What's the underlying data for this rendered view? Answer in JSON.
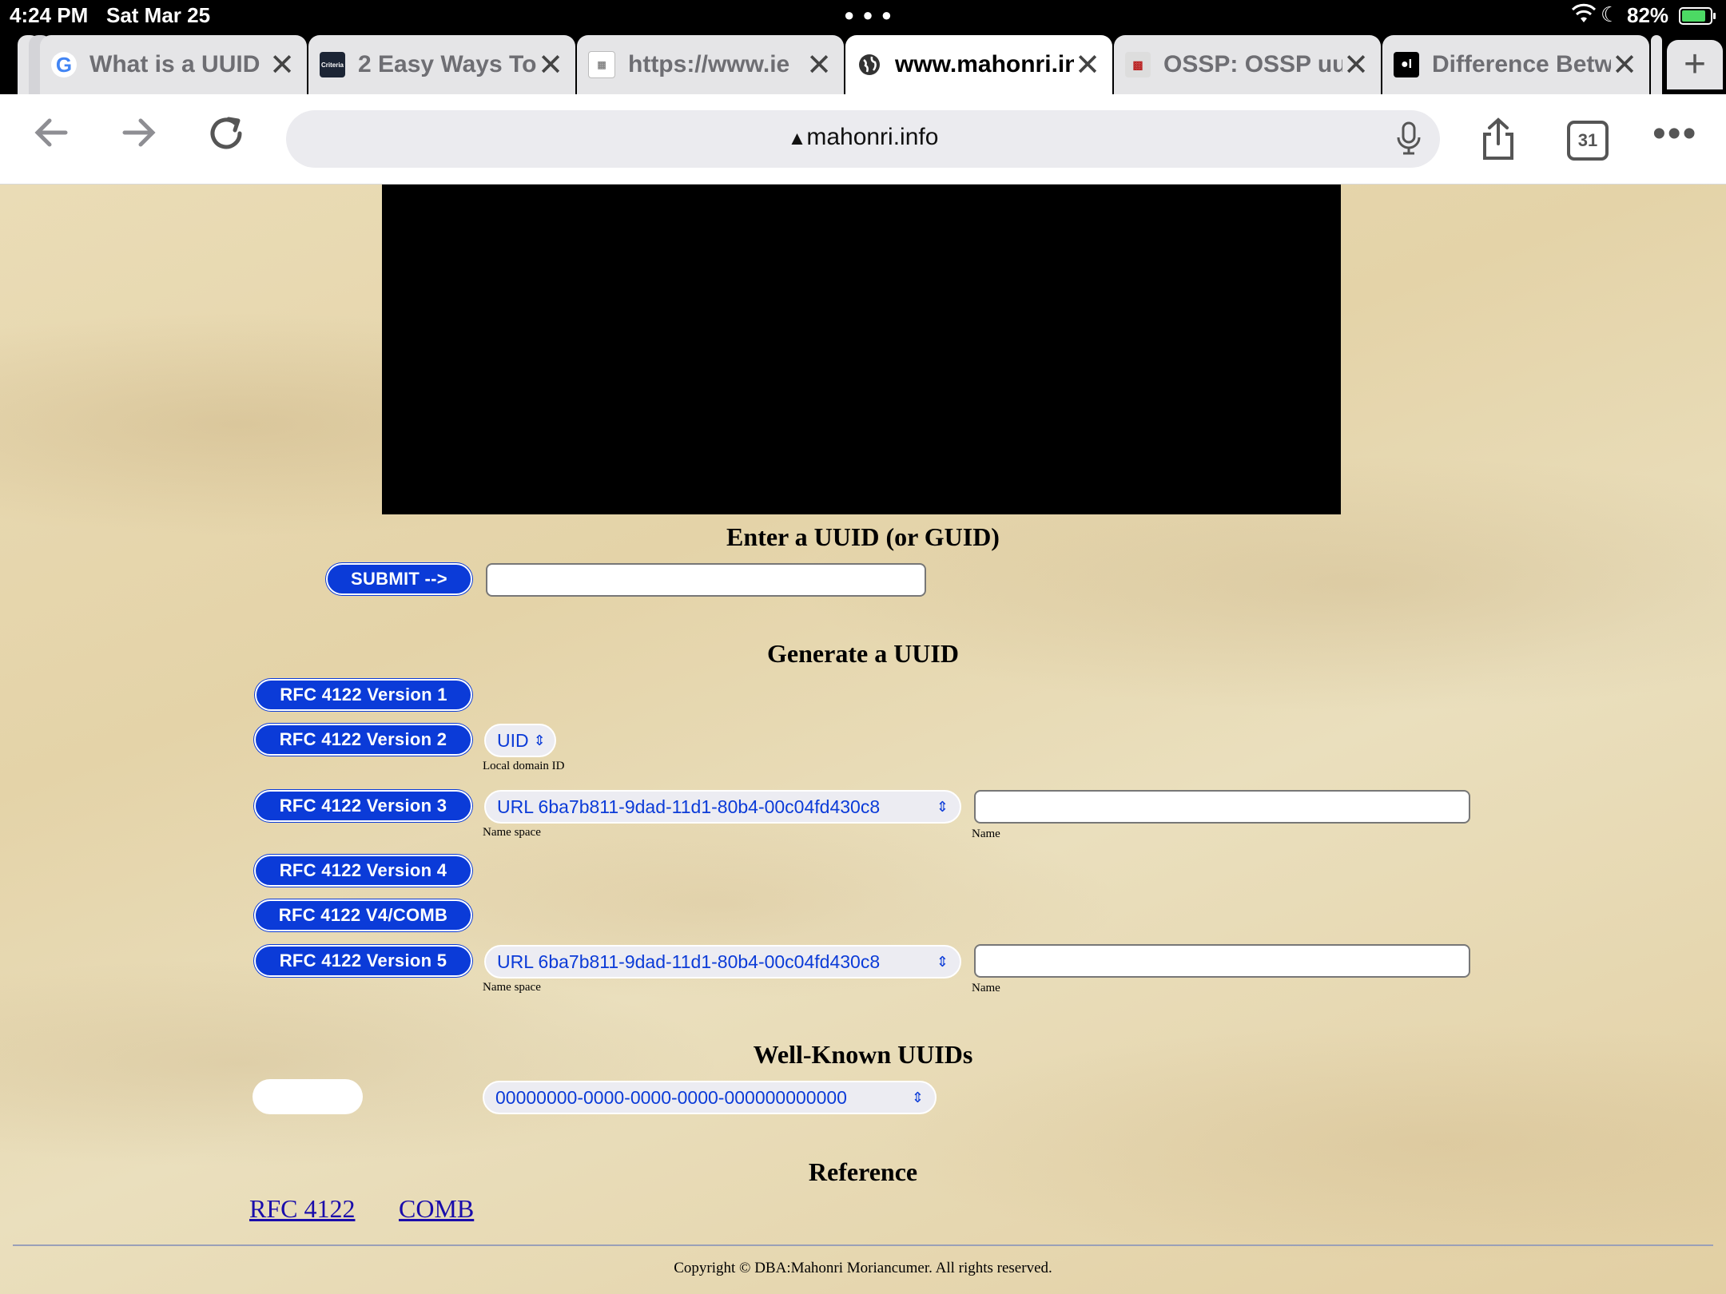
{
  "status": {
    "time": "4:24 PM",
    "date": "Sat Mar 25",
    "battery": "82%"
  },
  "tabs": [
    {
      "title": "What is a UUID",
      "icon": "G"
    },
    {
      "title": "2 Easy Ways To",
      "icon": "Criteria"
    },
    {
      "title": "https://www.ie",
      "icon": "img"
    },
    {
      "title": "www.mahonri.info",
      "icon": "globe"
    },
    {
      "title": "OSSP: OSSP uuid",
      "icon": "ossp"
    },
    {
      "title": "Difference Betw",
      "icon": "medium"
    }
  ],
  "toolbar": {
    "url": "mahonri.info",
    "tab_count": "31"
  },
  "page": {
    "enter_heading": "Enter a UUID (or GUID)",
    "submit_label": "SUBMIT -->",
    "generate_heading": "Generate a UUID",
    "v1_label": "RFC 4122 Version 1",
    "v2_label": "RFC 4122 Version 2",
    "v2_select": "UID",
    "v2_caption": "Local domain ID",
    "v3_label": "RFC 4122 Version 3",
    "v3_select": "URL 6ba7b811-9dad-11d1-80b4-00c04fd430c8",
    "namespace_caption": "Name space",
    "name_caption": "Name",
    "v4_label": "RFC 4122 Version 4",
    "comb_label": "RFC 4122 V4/COMB",
    "v5_label": "RFC 4122 Version 5",
    "v5_select": "URL 6ba7b811-9dad-11d1-80b4-00c04fd430c8",
    "wellknown_heading": "Well-Known UUIDs",
    "wellknown_select": "00000000-0000-0000-0000-000000000000",
    "reference_heading": "Reference",
    "ref_link1": "RFC 4122",
    "ref_link2": "COMB",
    "copyright": "Copyright © DBA:Mahonri Moriancumer. All rights reserved."
  }
}
